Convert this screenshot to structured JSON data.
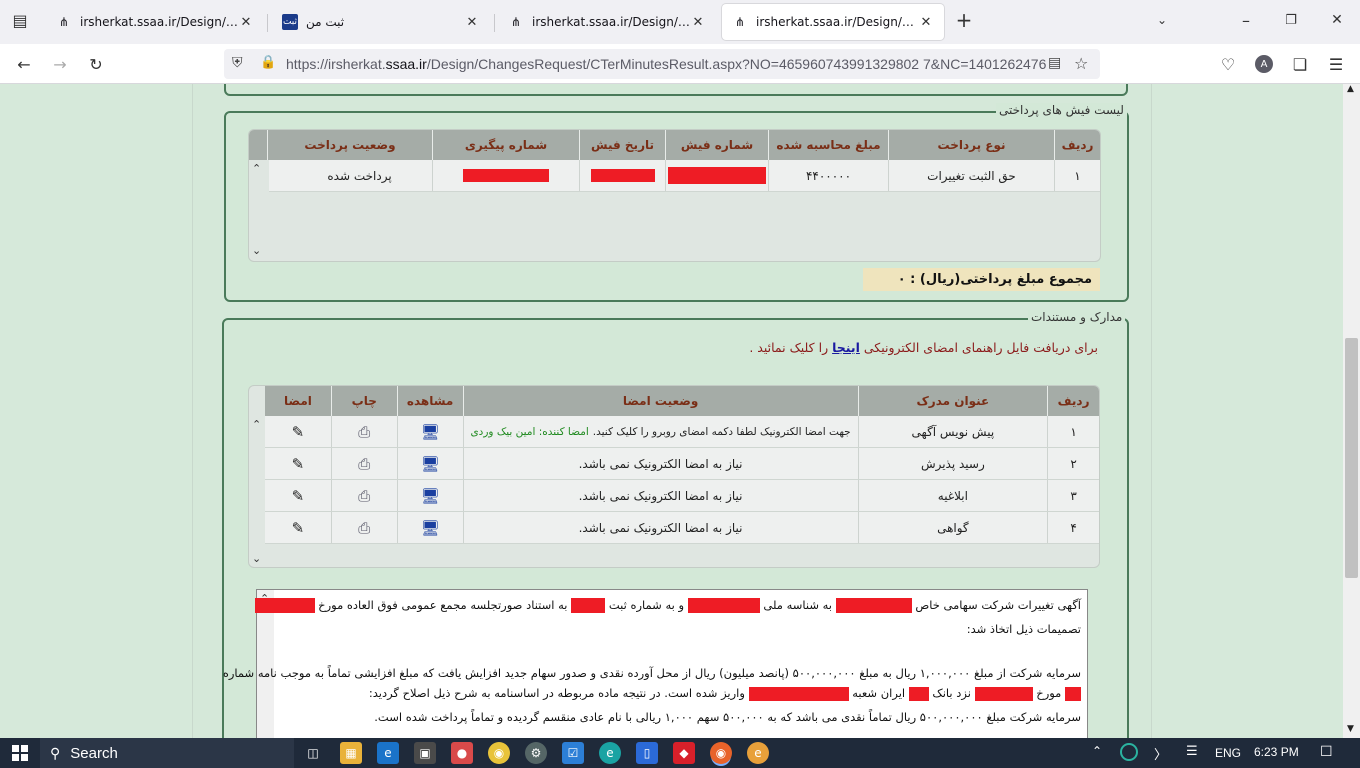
{
  "browser": {
    "tabs": [
      {
        "title": "irsherkat.ssaa.ir/Design/ChangesRequest/CTerMinutesResult.aspx",
        "active": false
      },
      {
        "title": "ثبت من",
        "active": false
      },
      {
        "title": "irsherkat.ssaa.ir/Design/ChangesRequest/CTerMinutesResult.aspx",
        "active": false
      },
      {
        "title": "irsherkat.ssaa.ir/Design/ChangesRequest/CTerMinutesResult.aspx",
        "active": true
      }
    ],
    "new_tab": "+",
    "url_prefix": "https://irsherkat.",
    "url_domain": "ssaa.ir",
    "url_rest": "/Design/ChangesRequest/CTerMinutesResult.aspx?NO=465960743991329802 7&NC=1401262476",
    "account_initial": "A"
  },
  "payments": {
    "legend": "لیست فیش های پرداختی",
    "columns": [
      "ردیف",
      "نوع پرداخت",
      "مبلغ محاسبه شده",
      "شماره فیش",
      "تاریخ فیش",
      "شماره پیگیری",
      "وضعیت پرداخت"
    ],
    "rows": [
      {
        "row": "۱",
        "type": "حق الثبت تغییرات",
        "amount": "۴۴۰۰۰۰۰",
        "status": "پرداخت شده"
      }
    ],
    "total_label": "مجموع مبلغ پرداختی(ریال) : ۰"
  },
  "documents": {
    "legend": "مدارک و مستندات",
    "guide_prefix": "برای دریافت فایل راهنمای امضای الکترونیکی",
    "guide_link": "اینجا",
    "guide_suffix": "را کلیک نمائید .",
    "columns": [
      "ردیف",
      "عنوان مدرک",
      "وضعیت امضا",
      "مشاهده",
      "چاپ",
      "امضا"
    ],
    "rows": [
      {
        "row": "۱",
        "title": "پیش نویس آگهی",
        "status_black": "جهت امضا الکترونیک لطفا دکمه امضای روبرو را کلیک کنید.",
        "status_green": "امضا کننده: امین بیک وردی"
      },
      {
        "row": "۲",
        "title": "رسید پذیرش",
        "status_black": "نیاز به امضا الکترونیک نمی باشد.",
        "status_green": ""
      },
      {
        "row": "۳",
        "title": "ابلاغیه",
        "status_black": "نیاز به امضا الکترونیک نمی باشد.",
        "status_green": ""
      },
      {
        "row": "۴",
        "title": "گواهی",
        "status_black": "نیاز به امضا الکترونیک نمی باشد.",
        "status_green": ""
      }
    ]
  },
  "notice": {
    "line1_a": "آگهی تغییرات شرکت سهامی خاص",
    "line1_b": "به شناسه ملی",
    "line1_c": "و به شماره ثبت",
    "line1_d": "به استناد صورتجلسه مجمع عمومی فوق العاده مورخ",
    "line2": "تصمیمات ذیل اتخاذ شد:",
    "line3": "سرمایه شرکت از مبلغ ۱,۰۰۰,۰۰۰ ریال به مبلغ ۵۰۰,۰۰۰,۰۰۰ (پانصد میلیون) ریال از محل آورده نقدی و صدور سهام جدید افزایش یافت که مبلغ افزایشی تماماً به موجب نامه شماره",
    "line4_a": "مورخ",
    "line4_b": "نزد بانک",
    "line4_c": "ایران شعبه",
    "line4_d": "واریز شده است. در نتیجه ماده مربوطه در اساسنامه به شرح ذیل اصلاح گردید:",
    "line5": "سرمایه شرکت مبلغ ۵۰۰,۰۰۰,۰۰۰ ریال تماماً نقدی می باشد که به ۵۰۰,۰۰۰ سهم ۱,۰۰۰ ریالی با نام عادی منقسم گردیده و تماماً پرداخت شده است."
  },
  "taskbar": {
    "search_label": "Search",
    "language": "ENG",
    "time": "6:23 PM"
  }
}
